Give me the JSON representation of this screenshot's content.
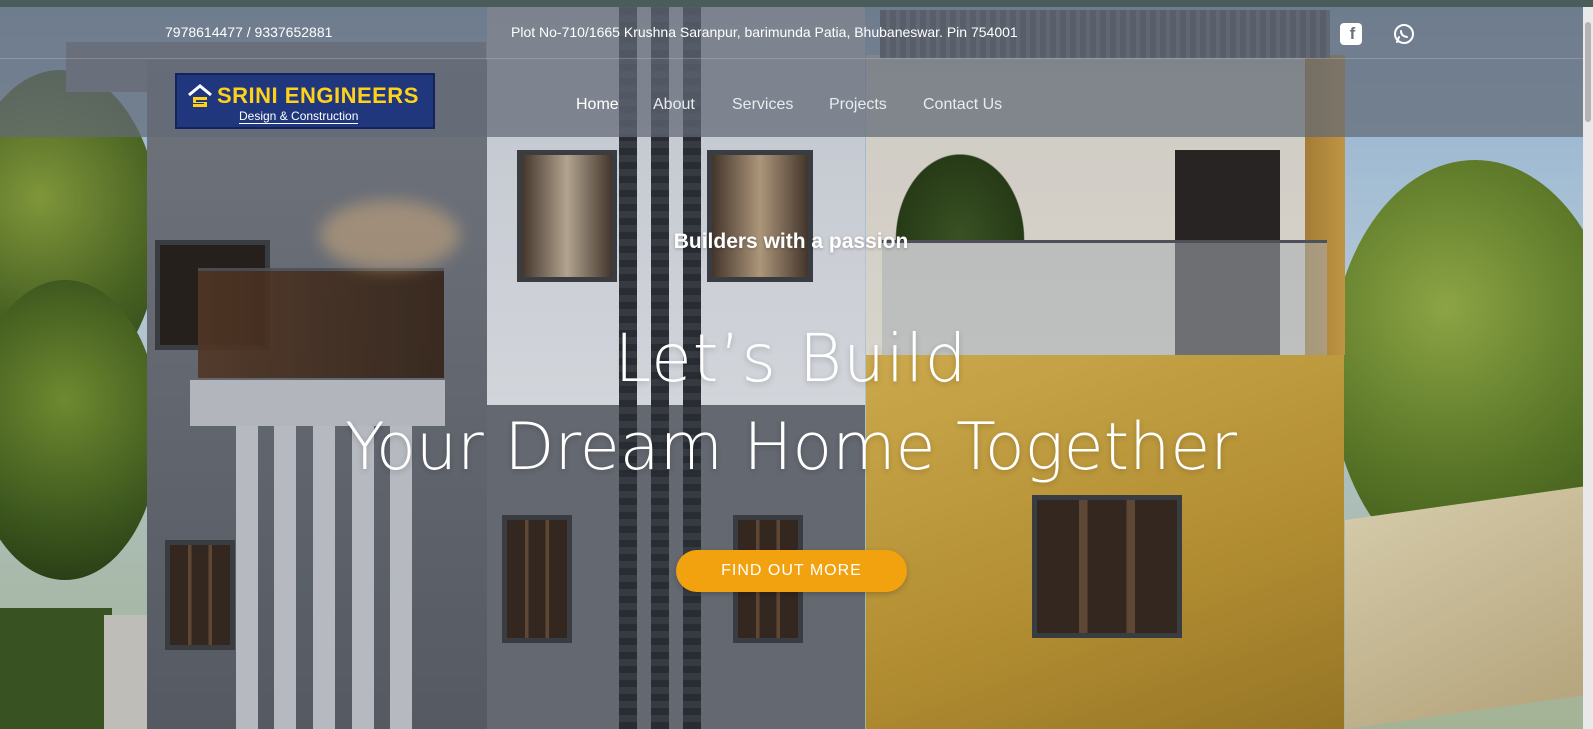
{
  "topbar": {
    "phones": "7978614477 / 9337652881",
    "address": "Plot No-710/1665 Krushna Saranpur, barimunda Patia, Bhubaneswar. Pin 754001",
    "social": [
      {
        "icon": "facebook-icon"
      },
      {
        "icon": "whatsapp-icon"
      }
    ]
  },
  "logo": {
    "name": "SRINI ENGINEERS",
    "tagline": "Design & Construction",
    "colors": {
      "background": "#20377d",
      "name": "#ffd21a"
    }
  },
  "nav": {
    "items": [
      {
        "label": "Home",
        "active": true
      },
      {
        "label": "About"
      },
      {
        "label": "Services"
      },
      {
        "label": "Projects"
      },
      {
        "label": "Contact Us"
      }
    ]
  },
  "hero": {
    "kicker": "Builders with a passion",
    "headline_line1": "Let’s Build",
    "headline_line2": "Your Dream Home Together",
    "cta_label": "FIND OUT MORE",
    "cta_color": "#f2a20f"
  }
}
